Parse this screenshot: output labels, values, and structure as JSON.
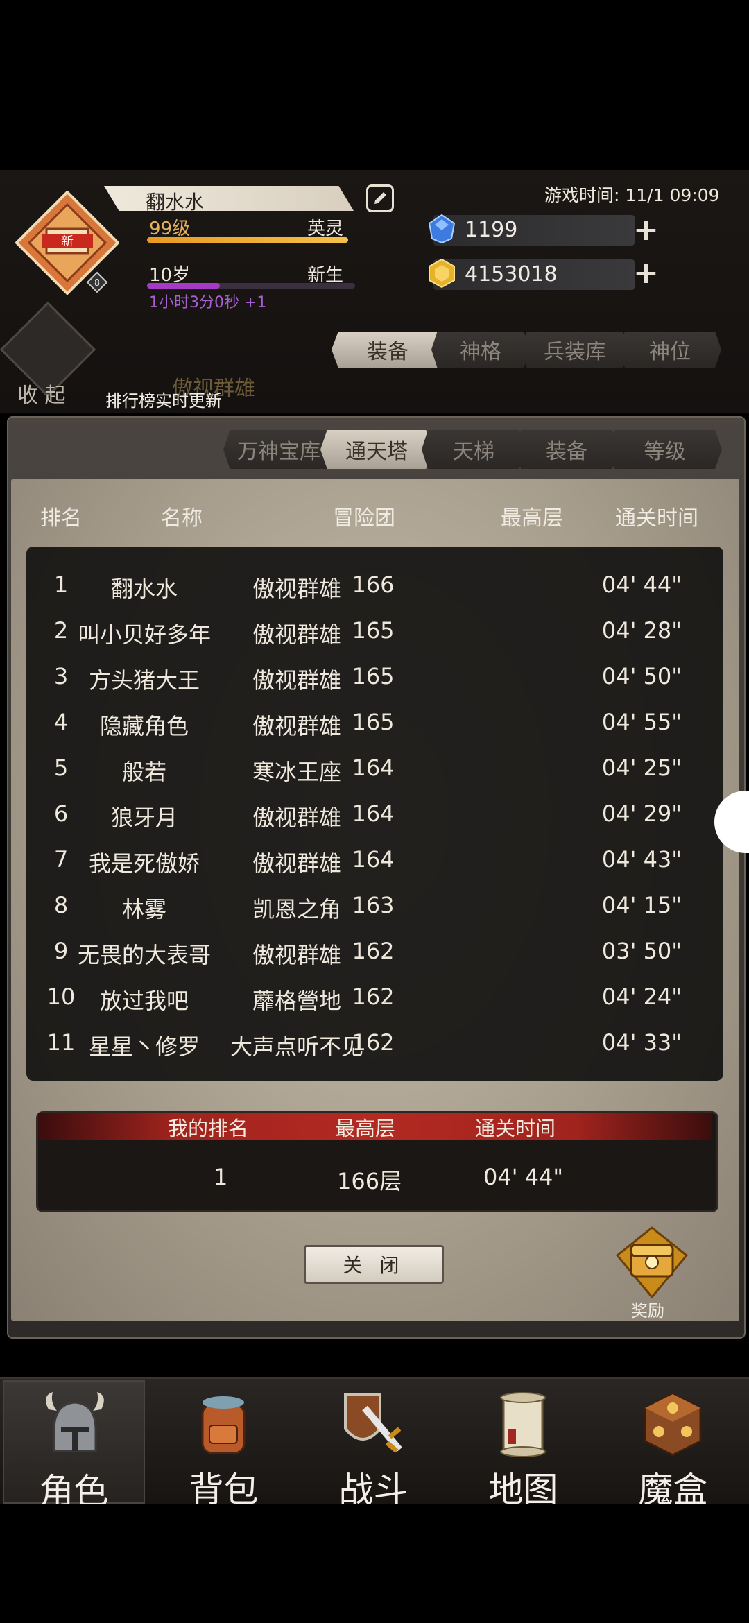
{
  "header": {
    "player_name": "翻水水",
    "game_time": "游戏时间: 11/1 09:09",
    "level": "99级",
    "level_class": "英灵",
    "level_progress": 1.0,
    "age": "10岁",
    "age_stage": "新生",
    "age_progress": 0.35,
    "timer": "1小时3分0秒 +1",
    "emblem_badge": "新",
    "emblem_level": "8",
    "gems": "1199",
    "gold": "4153018"
  },
  "main_tabs": [
    {
      "label": "装备",
      "active": true
    },
    {
      "label": "神格",
      "active": false
    },
    {
      "label": "兵装库",
      "active": false
    },
    {
      "label": "神位",
      "active": false
    }
  ],
  "collapse_label": "收 起",
  "realtime_notice": "排行榜实时更新",
  "guild_name_faint": "傲视群雄",
  "sub_tabs": [
    {
      "label": "万神宝库",
      "active": false
    },
    {
      "label": "通天塔",
      "active": true
    },
    {
      "label": "天梯",
      "active": false
    },
    {
      "label": "装备",
      "active": false
    },
    {
      "label": "等级",
      "active": false
    }
  ],
  "table": {
    "headers": [
      "排名",
      "名称",
      "冒险团",
      "最高层",
      "通关时间"
    ],
    "rows": [
      [
        "1",
        "翻水水",
        "傲视群雄",
        "166",
        "04' 44\""
      ],
      [
        "2",
        "叫小贝好多年",
        "傲视群雄",
        "165",
        "04' 28\""
      ],
      [
        "3",
        "方头猪大王",
        "傲视群雄",
        "165",
        "04' 50\""
      ],
      [
        "4",
        "隐藏角色",
        "傲视群雄",
        "165",
        "04' 55\""
      ],
      [
        "5",
        "般若",
        "寒冰王座",
        "164",
        "04' 25\""
      ],
      [
        "6",
        "狼牙月",
        "傲视群雄",
        "164",
        "04' 29\""
      ],
      [
        "7",
        "我是死傲娇",
        "傲视群雄",
        "164",
        "04' 43\""
      ],
      [
        "8",
        "林雾",
        "凯恩之角",
        "163",
        "04' 15\""
      ],
      [
        "9",
        "无畏的大表哥",
        "傲视群雄",
        "162",
        "03' 50\""
      ],
      [
        "10",
        "放过我吧",
        "蘼格營地",
        "162",
        "04' 24\""
      ],
      [
        "11",
        "星星丶修罗",
        "大声点听不见",
        "162",
        "04' 33\""
      ]
    ]
  },
  "my_rank": {
    "headers": [
      "我的排名",
      "最高层",
      "通关时间"
    ],
    "rank": "1",
    "floor": "166层",
    "time": "04' 44\""
  },
  "close_label": "关 闭",
  "reward_label": "奖励",
  "nav": [
    {
      "label": "角色",
      "icon": "helmet-icon",
      "active": true
    },
    {
      "label": "背包",
      "icon": "backpack-icon",
      "active": false
    },
    {
      "label": "战斗",
      "icon": "sword-shield-icon",
      "active": false
    },
    {
      "label": "地图",
      "icon": "scroll-map-icon",
      "active": false
    },
    {
      "label": "魔盒",
      "icon": "magic-box-icon",
      "active": false
    }
  ],
  "colors": {
    "level_bar": "#f4c14a",
    "age_bar": "#a43bc4",
    "rank_header_red": "#b32a22",
    "gem": "#3d7be0",
    "gold": "#e6b22a"
  }
}
